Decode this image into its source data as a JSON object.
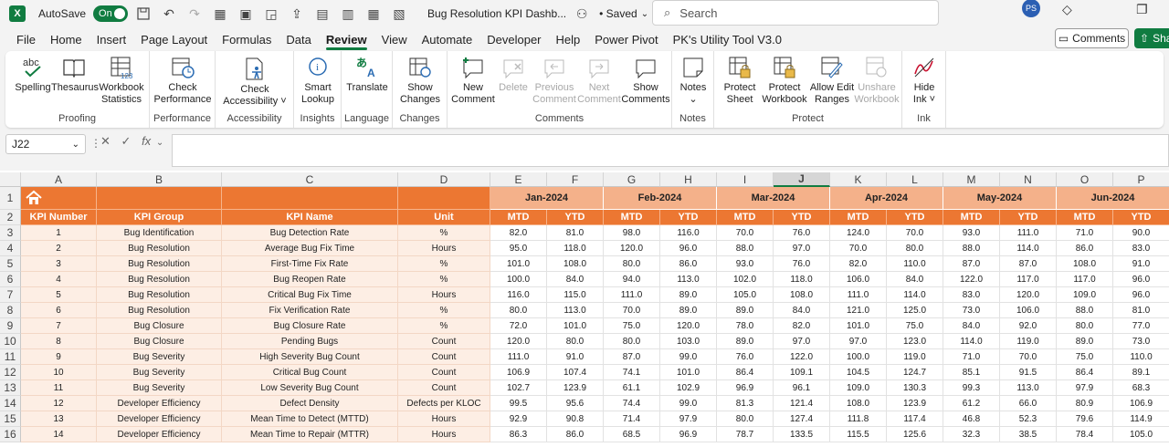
{
  "titlebar": {
    "logo": "X",
    "autosave_label": "AutoSave",
    "autosave_state": "On",
    "doc_title": "Bug Resolution KPI Dashb...",
    "saved": "• Saved",
    "search_placeholder": "Search",
    "avatar": "PS"
  },
  "menu": {
    "tabs": [
      "File",
      "Home",
      "Insert",
      "Page Layout",
      "Formulas",
      "Data",
      "Review",
      "View",
      "Automate",
      "Developer",
      "Help",
      "Power Pivot",
      "PK's Utility Tool V3.0"
    ],
    "active": "Review",
    "comments_label": "Comments",
    "share_label": "Shar"
  },
  "ribbon": {
    "groups": {
      "proofing": {
        "label": "Proofing",
        "spelling": "Spelling",
        "thesaurus": "Thesaurus",
        "workbook_stats": [
          "Workbook",
          "Statistics"
        ]
      },
      "performance": {
        "label": "Performance",
        "check_perf": [
          "Check",
          "Performance"
        ]
      },
      "accessibility": {
        "label": "Accessibility",
        "check_acc": [
          "Check",
          "Accessibility ˅"
        ]
      },
      "insights": {
        "label": "Insights",
        "smart_lookup": [
          "Smart",
          "Lookup"
        ]
      },
      "language": {
        "label": "Language",
        "translate": "Translate"
      },
      "changes": {
        "label": "Changes",
        "show_changes": [
          "Show",
          "Changes"
        ]
      },
      "comments": {
        "label": "Comments",
        "new_comment": [
          "New",
          "Comment"
        ],
        "delete": "Delete",
        "previous": [
          "Previous",
          "Comment"
        ],
        "next": [
          "Next",
          "Comment"
        ],
        "show_comments": [
          "Show",
          "Comments"
        ]
      },
      "notes": {
        "label": "Notes",
        "notes": "Notes"
      },
      "protect": {
        "label": "Protect",
        "protect_sheet": [
          "Protect",
          "Sheet"
        ],
        "protect_workbook": [
          "Protect",
          "Workbook"
        ],
        "allow_edit": [
          "Allow Edit",
          "Ranges"
        ],
        "unshare": [
          "Unshare",
          "Workbook"
        ]
      },
      "ink": {
        "label": "Ink",
        "hide_ink": [
          "Hide",
          "Ink ˅"
        ]
      }
    }
  },
  "formula_bar": {
    "name_box": "J22",
    "fx": "fx",
    "value": ""
  },
  "grid": {
    "columns": [
      "A",
      "B",
      "C",
      "D",
      "E",
      "F",
      "G",
      "H",
      "I",
      "J",
      "K",
      "L",
      "M",
      "N",
      "O",
      "P"
    ],
    "selected_column": "J",
    "row_numbers": [
      "1",
      "2",
      "3",
      "4",
      "5",
      "6",
      "7",
      "8",
      "9",
      "10",
      "11",
      "12",
      "13",
      "14",
      "15",
      "16"
    ],
    "headers": {
      "kpi_number": "KPI Number",
      "kpi_group": "KPI Group",
      "kpi_name": "KPI Name",
      "unit": "Unit"
    },
    "months": [
      "Jan-2024",
      "Feb-2024",
      "Mar-2024",
      "Apr-2024",
      "May-2024",
      "Jun-2024"
    ],
    "sub_headers": [
      "MTD",
      "YTD"
    ],
    "rows": [
      {
        "num": "1",
        "group": "Bug Identification",
        "name": "Bug Detection Rate",
        "unit": "%",
        "vals": [
          "82.0",
          "81.0",
          "98.0",
          "116.0",
          "70.0",
          "76.0",
          "124.0",
          "70.0",
          "93.0",
          "111.0",
          "71.0",
          "90.0"
        ]
      },
      {
        "num": "2",
        "group": "Bug Resolution",
        "name": "Average Bug Fix Time",
        "unit": "Hours",
        "vals": [
          "95.0",
          "118.0",
          "120.0",
          "96.0",
          "88.0",
          "97.0",
          "70.0",
          "80.0",
          "88.0",
          "114.0",
          "86.0",
          "83.0"
        ]
      },
      {
        "num": "3",
        "group": "Bug Resolution",
        "name": "First-Time Fix Rate",
        "unit": "%",
        "vals": [
          "101.0",
          "108.0",
          "80.0",
          "86.0",
          "93.0",
          "76.0",
          "82.0",
          "110.0",
          "87.0",
          "87.0",
          "108.0",
          "91.0"
        ]
      },
      {
        "num": "4",
        "group": "Bug Resolution",
        "name": "Bug Reopen Rate",
        "unit": "%",
        "vals": [
          "100.0",
          "84.0",
          "94.0",
          "113.0",
          "102.0",
          "118.0",
          "106.0",
          "84.0",
          "122.0",
          "117.0",
          "117.0",
          "96.0"
        ]
      },
      {
        "num": "5",
        "group": "Bug Resolution",
        "name": "Critical Bug Fix Time",
        "unit": "Hours",
        "vals": [
          "116.0",
          "115.0",
          "111.0",
          "89.0",
          "105.0",
          "108.0",
          "111.0",
          "114.0",
          "83.0",
          "120.0",
          "109.0",
          "96.0"
        ]
      },
      {
        "num": "6",
        "group": "Bug Resolution",
        "name": "Fix Verification Rate",
        "unit": "%",
        "vals": [
          "80.0",
          "113.0",
          "70.0",
          "89.0",
          "89.0",
          "84.0",
          "121.0",
          "125.0",
          "73.0",
          "106.0",
          "88.0",
          "81.0"
        ]
      },
      {
        "num": "7",
        "group": "Bug Closure",
        "name": "Bug Closure Rate",
        "unit": "%",
        "vals": [
          "72.0",
          "101.0",
          "75.0",
          "120.0",
          "78.0",
          "82.0",
          "101.0",
          "75.0",
          "84.0",
          "92.0",
          "80.0",
          "77.0"
        ]
      },
      {
        "num": "8",
        "group": "Bug Closure",
        "name": "Pending Bugs",
        "unit": "Count",
        "vals": [
          "120.0",
          "80.0",
          "80.0",
          "103.0",
          "89.0",
          "97.0",
          "97.0",
          "123.0",
          "114.0",
          "119.0",
          "89.0",
          "73.0"
        ]
      },
      {
        "num": "9",
        "group": "Bug Severity",
        "name": "High Severity Bug Count",
        "unit": "Count",
        "vals": [
          "111.0",
          "91.0",
          "87.0",
          "99.0",
          "76.0",
          "122.0",
          "100.0",
          "119.0",
          "71.0",
          "70.0",
          "75.0",
          "110.0"
        ]
      },
      {
        "num": "10",
        "group": "Bug Severity",
        "name": "Critical Bug Count",
        "unit": "Count",
        "vals": [
          "106.9",
          "107.4",
          "74.1",
          "101.0",
          "86.4",
          "109.1",
          "104.5",
          "124.7",
          "85.1",
          "91.5",
          "86.4",
          "89.1"
        ]
      },
      {
        "num": "11",
        "group": "Bug Severity",
        "name": "Low Severity Bug Count",
        "unit": "Count",
        "vals": [
          "102.7",
          "123.9",
          "61.1",
          "102.9",
          "96.9",
          "96.1",
          "109.0",
          "130.3",
          "99.3",
          "113.0",
          "97.9",
          "68.3"
        ]
      },
      {
        "num": "12",
        "group": "Developer Efficiency",
        "name": "Defect Density",
        "unit": "Defects per KLOC",
        "vals": [
          "99.5",
          "95.6",
          "74.4",
          "99.0",
          "81.3",
          "121.4",
          "108.0",
          "123.9",
          "61.2",
          "66.0",
          "80.9",
          "106.9"
        ]
      },
      {
        "num": "13",
        "group": "Developer Efficiency",
        "name": "Mean Time to Detect (MTTD)",
        "unit": "Hours",
        "vals": [
          "92.9",
          "90.8",
          "71.4",
          "97.9",
          "80.0",
          "127.4",
          "111.8",
          "117.4",
          "46.8",
          "52.3",
          "79.6",
          "114.9"
        ]
      },
      {
        "num": "14",
        "group": "Developer Efficiency",
        "name": "Mean Time to Repair (MTTR)",
        "unit": "Hours",
        "vals": [
          "86.3",
          "86.0",
          "68.5",
          "96.9",
          "78.7",
          "133.5",
          "115.5",
          "125.6",
          "32.3",
          "38.5",
          "78.4",
          "105.0"
        ]
      }
    ]
  },
  "colors": {
    "accent": "#107c41",
    "header_orange": "#ec7732",
    "month_band": "#f4b18a",
    "body_tint": "#fdeee4"
  }
}
